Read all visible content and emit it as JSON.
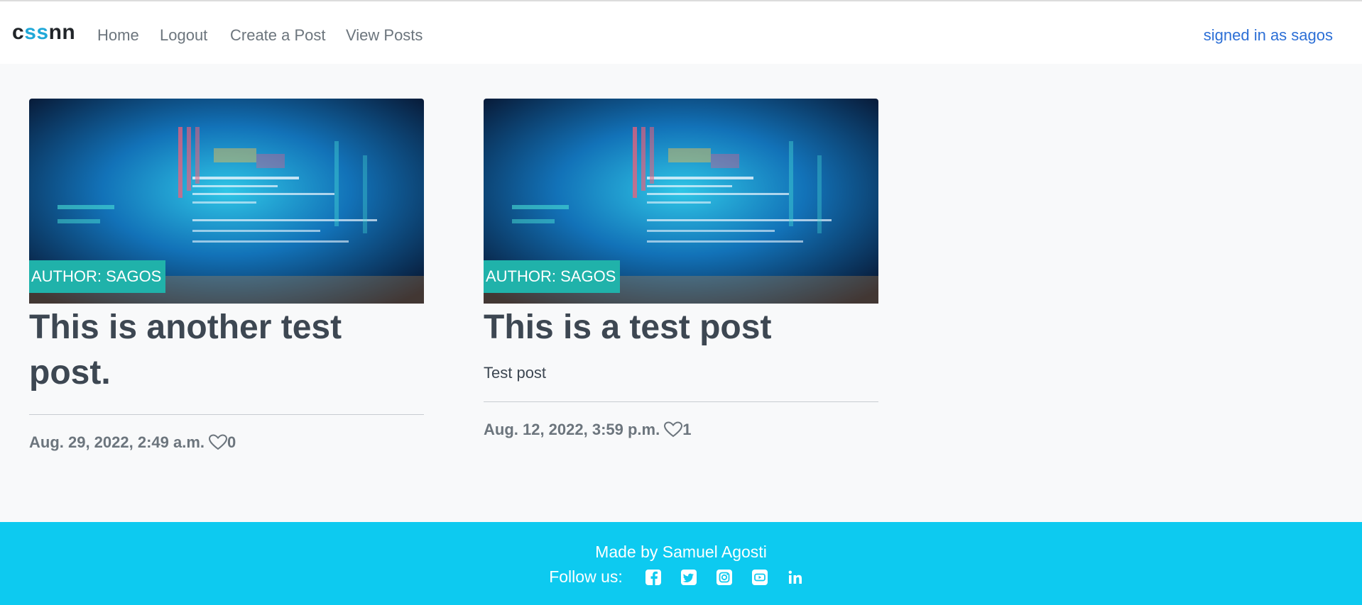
{
  "nav": {
    "brand": {
      "part1": "c",
      "part2": "ss",
      "part3": "nn"
    },
    "links": [
      "Home",
      "Logout",
      "Create a Post",
      "View Posts"
    ],
    "signed_in": "signed in as sagos"
  },
  "posts": [
    {
      "author": "AUTHOR: SAGOS",
      "title": "This is another test post.",
      "body": "",
      "date": "Aug. 29, 2022, 2:49 a.m.",
      "likes": "0"
    },
    {
      "author": "AUTHOR: SAGOS",
      "title": "This is a test post",
      "body": "Test post",
      "date": "Aug. 12, 2022, 3:59 p.m.",
      "likes": "1"
    }
  ],
  "footer": {
    "made_by": "Made by Samuel Agosti",
    "follow_label": "Follow us:",
    "social_icons": [
      "facebook-icon",
      "twitter-icon",
      "instagram-icon",
      "youtube-icon",
      "linkedin-icon"
    ]
  },
  "colors": {
    "background": "#f8f9fa",
    "accent": "#0dcaf0",
    "author_badge": "#20b2aa",
    "signed_in_link": "#2c6fd6"
  }
}
